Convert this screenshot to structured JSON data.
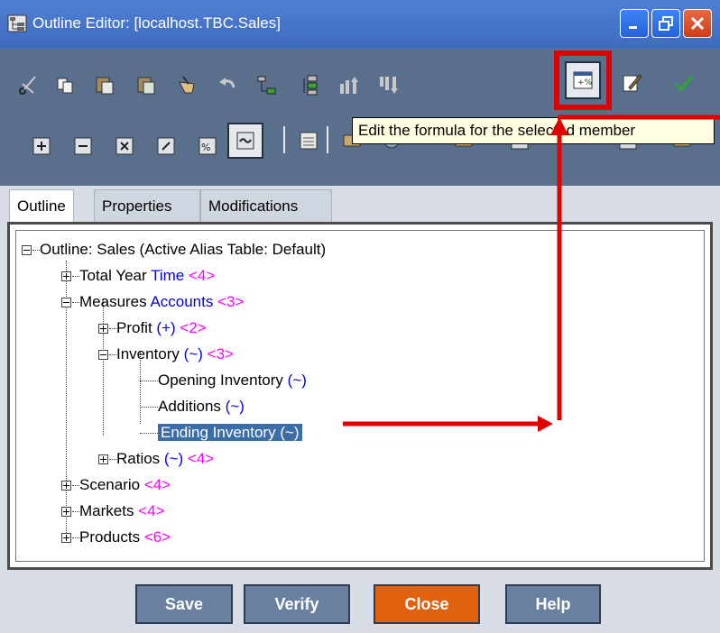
{
  "window": {
    "title": "Outline Editor: [localhost.TBC.Sales]",
    "buttons": {
      "minimize": "minimize-icon",
      "maximize": "restore-icon",
      "close": "close-icon"
    }
  },
  "toolbar": {
    "row1": [
      "cut-icon",
      "copy-icon",
      "paste-icon",
      "paste-special-icon",
      "clear-icon",
      "undo-icon",
      "add-child-icon",
      "add-sibling-icon",
      "move-up-icon",
      "move-down-icon",
      "edit-formula-icon",
      "edit-properties-icon",
      "verify-check-icon"
    ],
    "row2": [
      "consolidate-add-icon",
      "consolidate-subtract-icon",
      "consolidate-multiply-icon",
      "consolidate-divide-icon",
      "consolidate-percent-icon",
      "consolidate-ignore-icon",
      "toolbar-icon-a",
      "toolbar-icon-b",
      "toolbar-icon-c",
      "toolbar-icon-d",
      "toolbar-icon-e",
      "toolbar-icon-f",
      "toolbar-icon-g"
    ],
    "tooltip": "Edit the formula for the selected member"
  },
  "tabs": [
    "Outline",
    "Properties",
    "Modifications"
  ],
  "tree": {
    "root": "Outline: Sales (Active Alias Table: Default)",
    "total_year": {
      "name": "Total Year",
      "type": "Time",
      "count": "<4>"
    },
    "measures": {
      "name": "Measures",
      "type": "Accounts",
      "count": "<3>"
    },
    "profit": {
      "name": "Profit",
      "op": "(+)",
      "count": "<2>"
    },
    "inventory": {
      "name": "Inventory",
      "op": "(~)",
      "count": "<3>"
    },
    "opening_inventory": {
      "name": "Opening Inventory",
      "op": "(~)"
    },
    "additions": {
      "name": "Additions",
      "op": "(~)"
    },
    "ending_inventory": {
      "name": "Ending Inventory",
      "op": "(~)"
    },
    "ratios": {
      "name": "Ratios",
      "op": "(~)",
      "count": "<4>"
    },
    "scenario": {
      "name": "Scenario",
      "count": "<4>"
    },
    "markets": {
      "name": "Markets",
      "count": "<4>"
    },
    "products": {
      "name": "Products",
      "count": "<6>"
    }
  },
  "buttons": {
    "save": "Save",
    "verify": "Verify",
    "close": "Close",
    "help": "Help"
  },
  "colors": {
    "toolbar": "#5a6f8c",
    "accent_close": "#e0620f",
    "annotation": "#e00000",
    "selection": "#3b6ea8"
  }
}
